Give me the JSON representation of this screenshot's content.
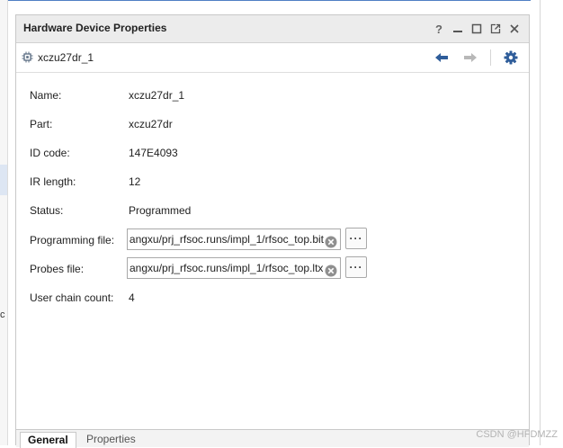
{
  "window": {
    "title": "Hardware Device Properties",
    "controls": [
      "help-icon",
      "minimize-icon",
      "maximize-icon",
      "float-icon",
      "close-icon"
    ],
    "help_label": "?"
  },
  "device": {
    "icon": "chip-icon",
    "name": "xczu27dr_1"
  },
  "toolbar": {
    "back_icon": "arrow-left-icon",
    "forward_icon": "arrow-right-icon",
    "settings_icon": "gear-icon"
  },
  "properties": {
    "name": {
      "label": "Name:",
      "value": "xczu27dr_1"
    },
    "part": {
      "label": "Part:",
      "value": "xczu27dr"
    },
    "id_code": {
      "label": "ID code:",
      "value": "147E4093"
    },
    "ir_length": {
      "label": "IR length:",
      "value": "12"
    },
    "status": {
      "label": "Status:",
      "value": "Programmed"
    },
    "programming_file": {
      "label": "Programming file:",
      "value": "angxu/prj_rfsoc.runs/impl_1/rfsoc_top.bit"
    },
    "probes_file": {
      "label": "Probes file:",
      "value": "angxu/prj_rfsoc.runs/impl_1/rfsoc_top.ltx"
    },
    "user_chain_count": {
      "label": "User chain count:",
      "value": "4"
    }
  },
  "more_button_label": "···",
  "tabs": [
    {
      "label": "General",
      "active": true
    },
    {
      "label": "Properties",
      "active": false
    }
  ],
  "edge_char": "c",
  "watermark": "CSDN @HFDMZZ",
  "colors": {
    "accent": "#2f5d9a",
    "title_bar": "#ececec",
    "border": "#c8c8c8"
  }
}
